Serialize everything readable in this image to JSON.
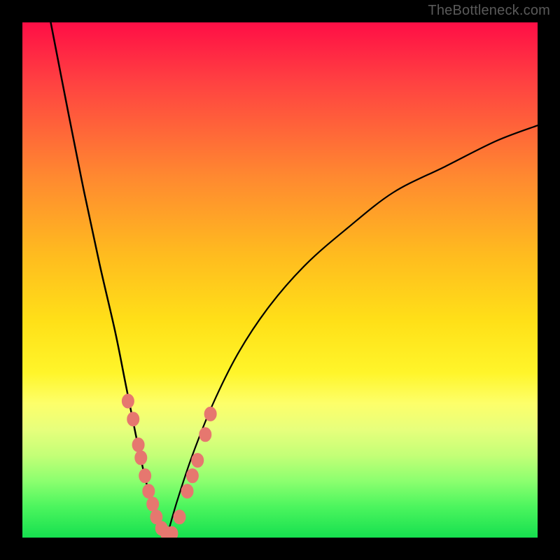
{
  "watermark": "TheBottleneck.com",
  "colors": {
    "frame": "#000000",
    "gradient_top": "#ff0e46",
    "gradient_bottom": "#16e04f",
    "curve": "#000000",
    "scatter": "#e6776f",
    "watermark": "#5a5a5a"
  },
  "chart_data": {
    "type": "line",
    "title": "",
    "xlabel": "",
    "ylabel": "",
    "xlim": [
      0,
      100
    ],
    "ylim": [
      0,
      100
    ],
    "grid": false,
    "legend": false,
    "note": "Axes are unlabeled; values below are percentage positions (0 = bottom/left, 100 = top/right) estimated from the image.",
    "series": [
      {
        "name": "left_curve",
        "type": "line",
        "x": [
          5.5,
          9,
          12,
          15,
          18,
          20,
          22,
          23.5,
          25,
          26.5,
          28
        ],
        "values": [
          100,
          82,
          67,
          53,
          40,
          30,
          20,
          13,
          7,
          2,
          0
        ]
      },
      {
        "name": "right_curve",
        "type": "line",
        "x": [
          28,
          30,
          33,
          37,
          42,
          48,
          55,
          63,
          72,
          82,
          92,
          100
        ],
        "values": [
          0,
          7,
          16,
          26,
          36,
          45,
          53,
          60,
          67,
          72,
          77,
          80
        ]
      },
      {
        "name": "scatter_points",
        "type": "scatter",
        "x": [
          20.5,
          21.5,
          22.5,
          23.0,
          23.8,
          24.5,
          25.3,
          26.0,
          27.0,
          28.0,
          29.0,
          30.5,
          32.0,
          33.0,
          34.0,
          35.5,
          36.5
        ],
        "values": [
          26.5,
          23.0,
          18,
          15.5,
          12,
          9,
          6.5,
          4,
          1.8,
          0.8,
          0.8,
          4,
          9,
          12,
          15,
          20.0,
          24
        ]
      }
    ]
  }
}
